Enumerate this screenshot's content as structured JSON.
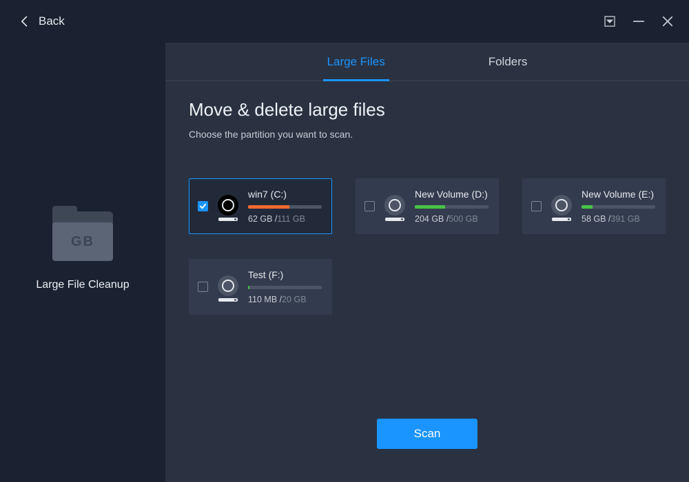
{
  "titlebar": {
    "back_label": "Back"
  },
  "sidebar": {
    "title": "Large File Cleanup",
    "folder_badge_text": "GB"
  },
  "tabs": {
    "large_files": "Large Files",
    "folders": "Folders",
    "active": "large_files"
  },
  "heading": {
    "title": "Move & delete large files",
    "subtitle": "Choose the partition you want to scan."
  },
  "partitions": [
    {
      "name": "win7 (C:)",
      "used": "62 GB",
      "total": "111 GB",
      "fill_pct": 56,
      "fill_color": "#ef6a2f",
      "selected": true
    },
    {
      "name": "New Volume (D:)",
      "used": "204 GB",
      "total": "500 GB",
      "fill_pct": 41,
      "fill_color": "#48c248",
      "selected": false
    },
    {
      "name": "New Volume (E:)",
      "used": "58 GB",
      "total": "391 GB",
      "fill_pct": 15,
      "fill_color": "#48c248",
      "selected": false
    },
    {
      "name": "Test (F:)",
      "used": "110 MB",
      "total": "20 GB",
      "fill_pct": 2,
      "fill_color": "#48c248",
      "selected": false
    }
  ],
  "scan_button": "Scan"
}
